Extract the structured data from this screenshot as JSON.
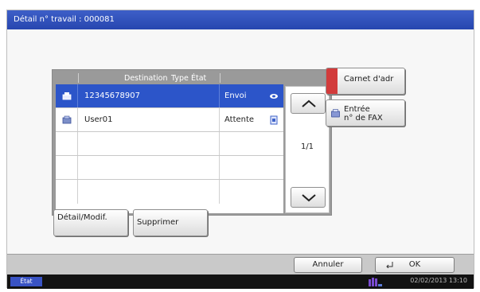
{
  "window": {
    "title": "Détail n° travail : 000081"
  },
  "table": {
    "headers": {
      "destination": "Destination",
      "type": "Type",
      "state": "État"
    },
    "rows": [
      {
        "icon": "fax-icon",
        "destination": "12345678907",
        "state": "Envoi",
        "selected": true
      },
      {
        "icon": "user-icon",
        "destination": "User01",
        "state": "Attente",
        "selected": false
      },
      {
        "destination": "",
        "state": ""
      },
      {
        "destination": "",
        "state": ""
      },
      {
        "destination": "",
        "state": ""
      }
    ],
    "page_indicator": "1/1"
  },
  "side_buttons": {
    "address_book": "Carnet d'adr",
    "fax_entry_line1": "Entrée",
    "fax_entry_line2": "n° de FAX"
  },
  "actions": {
    "detail": "Détail/Modif.",
    "delete": "Supprimer"
  },
  "footer": {
    "cancel": "Annuler",
    "ok": "OK"
  },
  "statusbar": {
    "state_label": "État",
    "datetime": "02/02/2013  13:10"
  },
  "colors": {
    "title_blue": "#2c4fbb",
    "selected_row": "#2c55c9",
    "address_book_icon": "#d23b3b",
    "status_bar": "#121212"
  }
}
